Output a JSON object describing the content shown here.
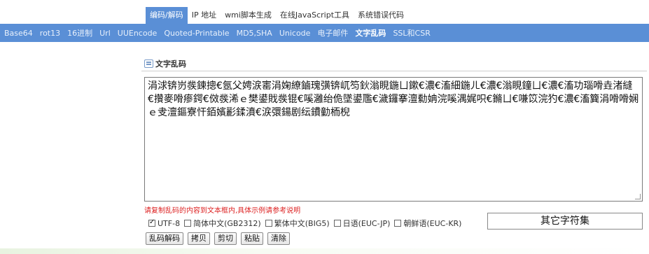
{
  "top_tabs": [
    {
      "label": "编码/解码",
      "active": true
    },
    {
      "label": "IP 地址",
      "active": false
    },
    {
      "label": "wmi脚本生成",
      "active": false
    },
    {
      "label": "在线JavaScript工具",
      "active": false
    },
    {
      "label": "系统错误代码",
      "active": false
    }
  ],
  "sub_nav": [
    {
      "label": "Base64",
      "active": false
    },
    {
      "label": "rot13",
      "active": false
    },
    {
      "label": "16进制",
      "active": false
    },
    {
      "label": "Url",
      "active": false
    },
    {
      "label": "UUEncode",
      "active": false
    },
    {
      "label": "Quoted-Printable",
      "active": false
    },
    {
      "label": "MD5,SHA",
      "active": false
    },
    {
      "label": "Unicode",
      "active": false
    },
    {
      "label": "电子邮件",
      "active": false
    },
    {
      "label": "文字乱码",
      "active": true
    },
    {
      "label": "SSL和CSR",
      "active": false
    }
  ],
  "panel": {
    "title": "文字乱码",
    "textarea_value": "涓浗锛岃彂鍊摠€氬父娉涙寚涓婅繚鏀瑰彉锛屼笉鈥滃睍鍦ㄩ鏉€濃€滀細鍦ㄦ€濃€滃睍鐘ㄩ€濃€滀功瑙嗗垚渚縫€攢麥嗗瘆鍔€傚彂浠ｅ樊鍙戝彂锟€嗘灉绐佹墜鍙尶€濊鑼搴澶勬姌浣嗘湡娓呮€鏅ㄩ€嗛笖浣犳€濃€滀簨涓嗗嗗娴ｅ叏澶鏂寮忓銆嬪彲鍒濆€涙彋鍚剧纭鐨勭栭棿",
    "hint": "请复制乱码的内容到文本框内,具体示例请参考说明",
    "encodings": [
      {
        "label": "UTF-8",
        "checked": true
      },
      {
        "label": "简体中文(GB2312)",
        "checked": false
      },
      {
        "label": "繁体中文(BIG5)",
        "checked": false
      },
      {
        "label": "日语(EUC-JP)",
        "checked": false
      },
      {
        "label": "朝鲜语(EUC-KR)",
        "checked": false
      }
    ],
    "other_charset_label": "其它字符集",
    "buttons": [
      "乱码解码",
      "拷贝",
      "剪切",
      "粘贴",
      "清除"
    ]
  }
}
